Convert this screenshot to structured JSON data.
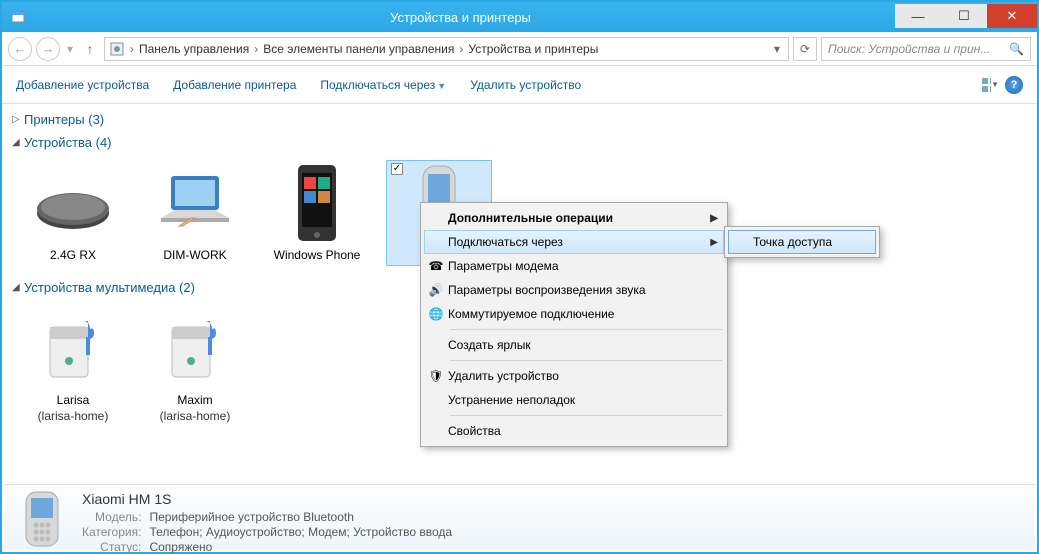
{
  "window": {
    "title": "Устройства и принтеры"
  },
  "breadcrumb": {
    "root_icon": "control-panel",
    "items": [
      "Панель управления",
      "Все элементы панели управления",
      "Устройства и принтеры"
    ]
  },
  "search": {
    "placeholder": "Поиск: Устройства и прин..."
  },
  "toolbar": {
    "add_device": "Добавление устройства",
    "add_printer": "Добавление принтера",
    "connect_via": "Подключаться через",
    "remove_device": "Удалить устройство"
  },
  "groups": {
    "printers": {
      "label": "Принтеры (3)",
      "expanded": false
    },
    "devices": {
      "label": "Устройства (4)",
      "expanded": true,
      "items": [
        {
          "name": "2.4G RX",
          "icon": "keyboard"
        },
        {
          "name": "DIM-WORK",
          "icon": "laptop"
        },
        {
          "name": "Windows Phone",
          "icon": "winphone"
        },
        {
          "name": "Xiaomi HM 1S",
          "icon": "phone",
          "selected": true,
          "checked": true,
          "display_name": "Xiaomi"
        }
      ]
    },
    "multimedia": {
      "label": "Устройства мультимедиа (2)",
      "expanded": true,
      "items": [
        {
          "name": "Larisa",
          "sub": "(larisa-home)",
          "icon": "mediaserver"
        },
        {
          "name": "Maxim",
          "sub": "(larisa-home)",
          "icon": "mediaserver"
        }
      ]
    }
  },
  "context_menu": {
    "items": [
      {
        "label": "Дополнительные операции",
        "submenu": true,
        "bold": true
      },
      {
        "label": "Подключаться через",
        "submenu": true,
        "highlighted": true
      },
      {
        "label": "Параметры модема",
        "icon": "modem"
      },
      {
        "label": "Параметры воспроизведения звука",
        "icon": "sound"
      },
      {
        "label": "Коммутируемое подключение",
        "icon": "dialup"
      },
      {
        "sep": true
      },
      {
        "label": "Создать ярлык"
      },
      {
        "sep": true
      },
      {
        "label": "Удалить устройство",
        "icon": "shield"
      },
      {
        "label": "Устранение неполадок"
      },
      {
        "sep": true
      },
      {
        "label": "Свойства"
      }
    ],
    "submenu": {
      "label": "Точка доступа"
    }
  },
  "details": {
    "title": "Xiaomi HM 1S",
    "rows": [
      {
        "k": "Модель:",
        "v": "Периферийное устройство Bluetooth"
      },
      {
        "k": "Категория:",
        "v": "Телефон; Аудиоустройство; Модем; Устройство ввода"
      },
      {
        "k": "Статус:",
        "v": "Сопряжено"
      }
    ]
  }
}
